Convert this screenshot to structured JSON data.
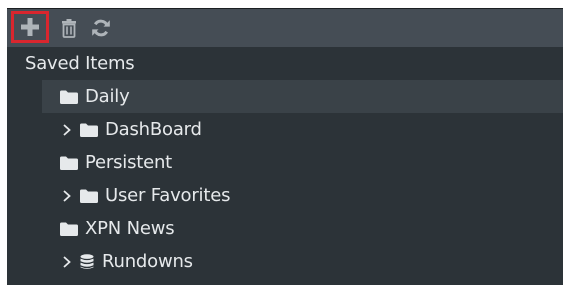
{
  "toolbar": {
    "buttons": [
      {
        "icon": "plus-icon"
      },
      {
        "icon": "trash-icon"
      },
      {
        "icon": "refresh-icon"
      }
    ]
  },
  "tree": {
    "root_label": "Saved Items",
    "items": [
      {
        "label": "Daily",
        "icon": "folder-icon",
        "expandable": false,
        "selected": true
      },
      {
        "label": "DashBoard",
        "icon": "folder-icon",
        "expandable": true,
        "selected": false
      },
      {
        "label": "Persistent",
        "icon": "folder-icon",
        "expandable": false,
        "selected": false
      },
      {
        "label": "User Favorites",
        "icon": "folder-icon",
        "expandable": true,
        "selected": false
      },
      {
        "label": "XPN News",
        "icon": "folder-icon",
        "expandable": false,
        "selected": false
      },
      {
        "label": "Rundowns",
        "icon": "database-icon",
        "expandable": true,
        "selected": false
      }
    ]
  },
  "colors": {
    "panel_bg": "#2c3338",
    "toolbar_bg": "#454d55",
    "selected_row_bg": "#3a4248",
    "text": "#e6e9eb",
    "icon": "#e6e9eb",
    "toolbar_icon": "#aeb4b9",
    "highlight_border": "#d9262e"
  }
}
